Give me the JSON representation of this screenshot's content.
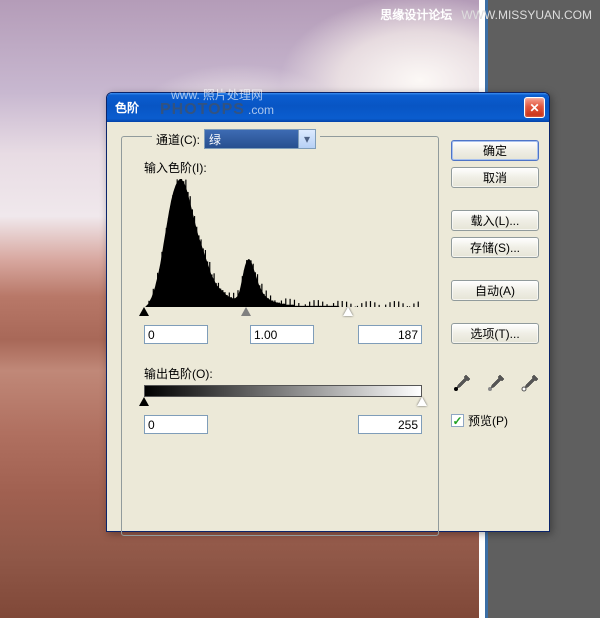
{
  "watermark_top": {
    "left": "思缘设计论坛",
    "right": "WWW.MISSYUAN.COM"
  },
  "watermark_center": {
    "line1": "www.",
    "line2": "照片处理网",
    "line3": "PHOTOPS",
    "line4": ".com"
  },
  "dialog": {
    "title": "色阶",
    "channel_label": "通道(C):",
    "channel_value": "绿",
    "input_label": "输入色阶(I):",
    "output_label": "输出色阶(O):",
    "input_values": {
      "black": "0",
      "gamma": "1.00",
      "white": "187"
    },
    "output_values": {
      "black": "0",
      "white": "255"
    }
  },
  "buttons": {
    "ok": "确定",
    "cancel": "取消",
    "load": "载入(L)...",
    "save": "存储(S)...",
    "auto": "自动(A)",
    "options": "选项(T)..."
  },
  "preview_label": "预览(P)",
  "preview_checked": true,
  "chart_data": {
    "type": "histogram",
    "title": "输入色阶",
    "xlabel": "",
    "ylabel": "",
    "x_range": [
      0,
      255
    ],
    "sliders": {
      "black": 0,
      "gamma_midpoint": 94,
      "white": 187
    },
    "values": [
      0,
      0,
      1,
      2,
      3,
      5,
      7,
      9,
      12,
      15,
      18,
      22,
      26,
      30,
      35,
      40,
      46,
      52,
      58,
      64,
      70,
      76,
      82,
      88,
      93,
      98,
      102,
      106,
      109,
      112,
      114,
      116,
      117,
      118,
      118,
      117,
      116,
      114,
      112,
      109,
      106,
      102,
      98,
      94,
      90,
      86,
      82,
      78,
      74,
      70,
      66,
      63,
      60,
      57,
      54,
      51,
      48,
      45,
      42,
      39,
      36,
      33,
      30,
      28,
      26,
      24,
      22,
      20,
      19,
      18,
      17,
      16,
      15,
      14,
      13,
      12,
      11,
      10,
      10,
      9,
      9,
      8,
      8,
      8,
      8,
      9,
      10,
      12,
      15,
      19,
      24,
      29,
      34,
      38,
      41,
      43,
      44,
      44,
      43,
      41,
      38,
      35,
      32,
      29,
      26,
      23,
      20,
      18,
      16,
      14,
      12,
      11,
      10,
      9,
      8,
      7,
      7,
      6,
      6,
      5,
      5,
      5,
      4,
      4,
      4,
      4,
      3,
      3,
      3,
      3,
      3,
      2,
      2,
      2,
      2,
      2,
      2,
      2,
      2,
      1,
      1,
      1,
      1,
      1,
      1,
      1,
      1,
      1,
      1,
      1,
      1,
      1,
      1,
      1,
      1,
      1,
      1,
      1,
      1,
      1,
      1,
      1,
      1,
      1,
      1,
      1,
      1,
      1,
      1,
      1,
      1,
      1,
      1,
      1,
      1,
      1,
      1,
      1,
      1,
      1,
      0,
      0,
      0,
      0,
      0,
      0,
      0,
      0,
      0,
      0,
      0,
      0,
      0,
      0,
      0,
      0,
      0,
      0,
      0,
      0,
      0,
      0,
      0,
      0,
      0,
      0,
      0,
      0,
      0,
      0,
      0,
      0,
      0,
      0,
      0,
      0,
      0,
      0,
      0,
      0,
      0,
      0,
      0,
      0,
      0,
      0,
      0,
      0,
      0,
      0,
      0,
      0,
      0,
      0,
      0,
      0,
      0,
      0,
      0,
      0,
      0,
      0,
      0,
      0,
      0,
      0,
      0,
      0,
      0,
      0,
      0,
      0,
      0,
      0,
      0,
      0
    ]
  }
}
